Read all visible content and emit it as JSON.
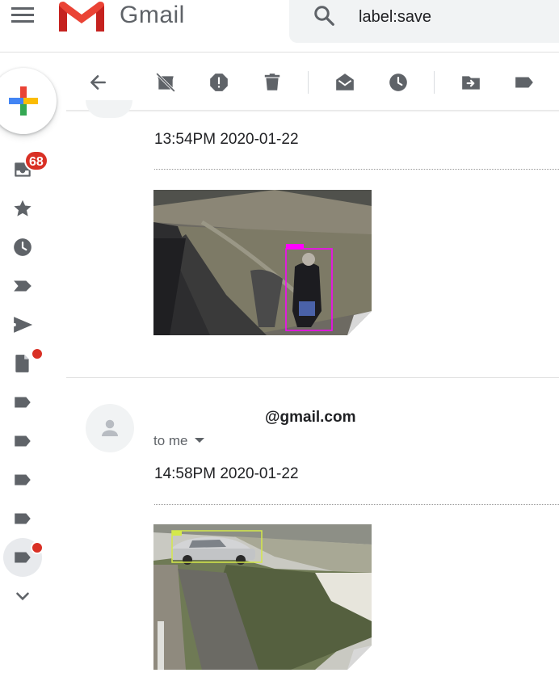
{
  "header": {
    "brand": "Gmail",
    "search": {
      "value": "label:save"
    }
  },
  "nav": {
    "inbox_count": "68",
    "items": [
      "inbox-icon",
      "star-icon",
      "clock-icon",
      "important-icon",
      "send-icon",
      "draft-icon",
      "label-icon",
      "label-icon",
      "label-icon",
      "label-icon",
      "label-icon",
      "expand-icon"
    ]
  },
  "toolbar": {
    "icons": [
      "back-arrow-icon",
      "archive-icon",
      "report-spam-icon",
      "delete-icon",
      "mark-unread-icon",
      "snooze-icon",
      "move-to-icon",
      "labels-icon"
    ]
  },
  "messages": [
    {
      "time": "13:54PM 2020-01-22",
      "attachment": "person-detection-snapshot"
    },
    {
      "sender": "@gmail.com",
      "recipients": "to me",
      "time": "14:58PM 2020-01-22",
      "attachment": "car-detection-snapshot"
    }
  ],
  "colors": {
    "badge": "#d93025",
    "icon": "#5f6368",
    "person_box": "#ff00ff",
    "car_box": "#d4e84a"
  }
}
